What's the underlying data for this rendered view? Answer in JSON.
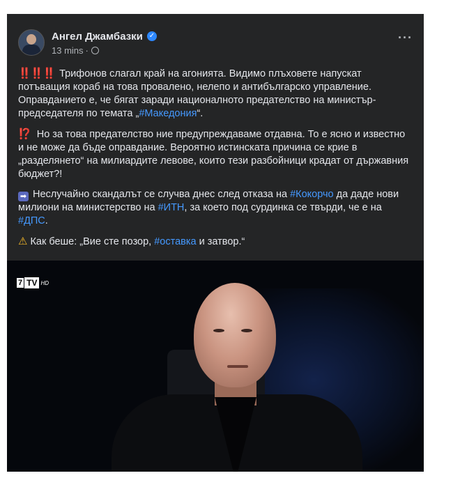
{
  "post": {
    "author": "Ангел Джамбазки",
    "time": "13 mins",
    "separator": "·",
    "more": "···",
    "verified_glyph": "✓",
    "icons": {
      "verified": "verified-badge-icon",
      "privacy": "globe-icon",
      "more": "more-options-icon"
    },
    "paragraphs": {
      "p1_emoji": "‼️‼️‼️",
      "p1_text": "Трифонов слагал край на агонията. Видимо плъховете напускат потъващия кораб на това провалено, нелепо и антибългарско управление. Оправданието е, че бягат заради националното предателство на министър-председателя по темата „",
      "p1_tag": "#Македония",
      "p1_end": "“.",
      "p2_emoji": "⁉️",
      "p2_text": "Но за това предателство ние предупреждаваме отдавна. То е ясно и известно и не може да бъде оправдание. Вероятно истинската причина се крие в „разделянето“ на милиардите левове, които тези разбойници крадат от държавния бюджет?!",
      "p3_emoji": "➡",
      "p3_text_a": "Неслучайно скандалът се случва днес след отказа на ",
      "p3_tag_a": "#Кокорчо",
      "p3_text_b": " да даде нови милиони на министерство на ",
      "p3_tag_b": "#ИТН",
      "p3_text_c": ", за което под сурдинка се твърди, че е на ",
      "p3_tag_c": "#ДПС",
      "p3_end": ".",
      "p4_emoji": "⚠",
      "p4_text_a": "Как беше: „Вие сте позор, ",
      "p4_tag": "#оставка",
      "p4_text_b": " и затвор.“"
    },
    "media": {
      "logo_number": "7",
      "logo_tv": "TV",
      "logo_hd": "HD"
    }
  },
  "colors": {
    "card": "#242526",
    "text": "#e4e6eb",
    "muted": "#b0b3b8",
    "hashtag": "#4599ff",
    "verified": "#2d88ff"
  }
}
